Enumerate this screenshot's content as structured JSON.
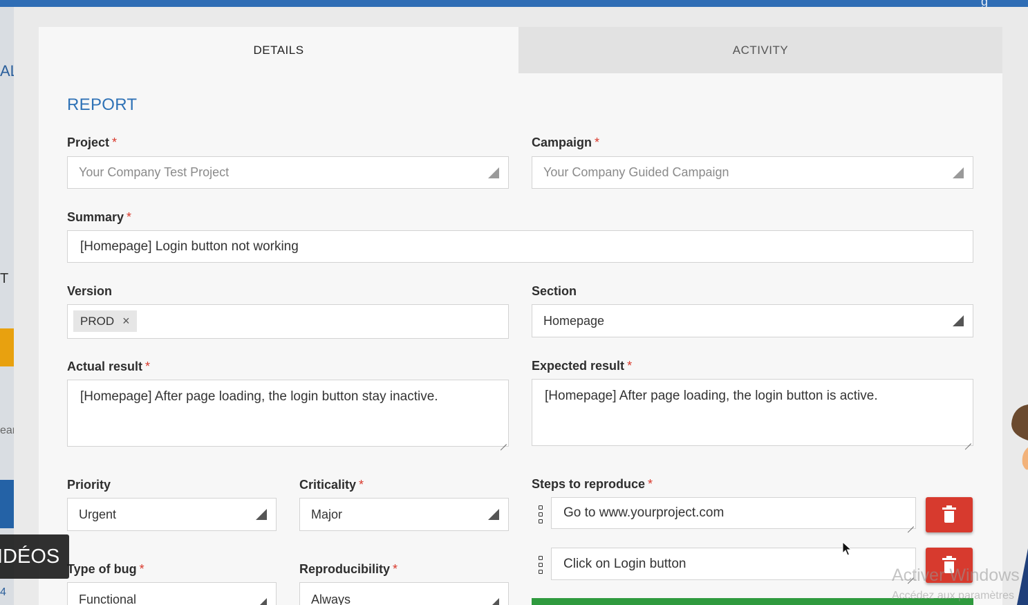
{
  "tabs": {
    "details": "DETAILS",
    "activity": "ACTIVITY"
  },
  "section_title": "REPORT",
  "required_mark": "*",
  "project": {
    "label": "Project",
    "value": "Your Company Test Project"
  },
  "campaign": {
    "label": "Campaign",
    "value": "Your Company Guided Campaign"
  },
  "summary": {
    "label": "Summary",
    "value": "[Homepage] Login button not working"
  },
  "version": {
    "label": "Version",
    "tag": "PROD",
    "remove_glyph": "×"
  },
  "section": {
    "label": "Section",
    "value": "Homepage"
  },
  "actual_result": {
    "label": "Actual result",
    "value": "[Homepage] After page loading, the login button stay inactive."
  },
  "expected_result": {
    "label": "Expected result",
    "value": "[Homepage] After page loading, the login button is active."
  },
  "priority": {
    "label": "Priority",
    "value": "Urgent"
  },
  "criticality": {
    "label": "Criticality",
    "value": "Major"
  },
  "steps": {
    "label": "Steps to reproduce",
    "items": [
      {
        "value": "Go to www.yourproject.com"
      },
      {
        "value": "Click on Login button"
      }
    ]
  },
  "type_of_bug": {
    "label": "Type of bug",
    "value": "Functional"
  },
  "reproducibility": {
    "label": "Reproducibility",
    "value": "Always"
  },
  "overlay": {
    "videos": "IDÉOS"
  },
  "watermark": {
    "line1": "Activer Windows",
    "line2": "Accédez aux paramètres"
  },
  "background_fragments": {
    "a": "AL",
    "b": "T",
    "c": "ear",
    "d": "4"
  },
  "colors": {
    "accent": "#2f72b6",
    "required": "#d9382b",
    "danger": "#d73a2e",
    "success": "#2f9a3e",
    "topbar": "#2f6db5"
  }
}
